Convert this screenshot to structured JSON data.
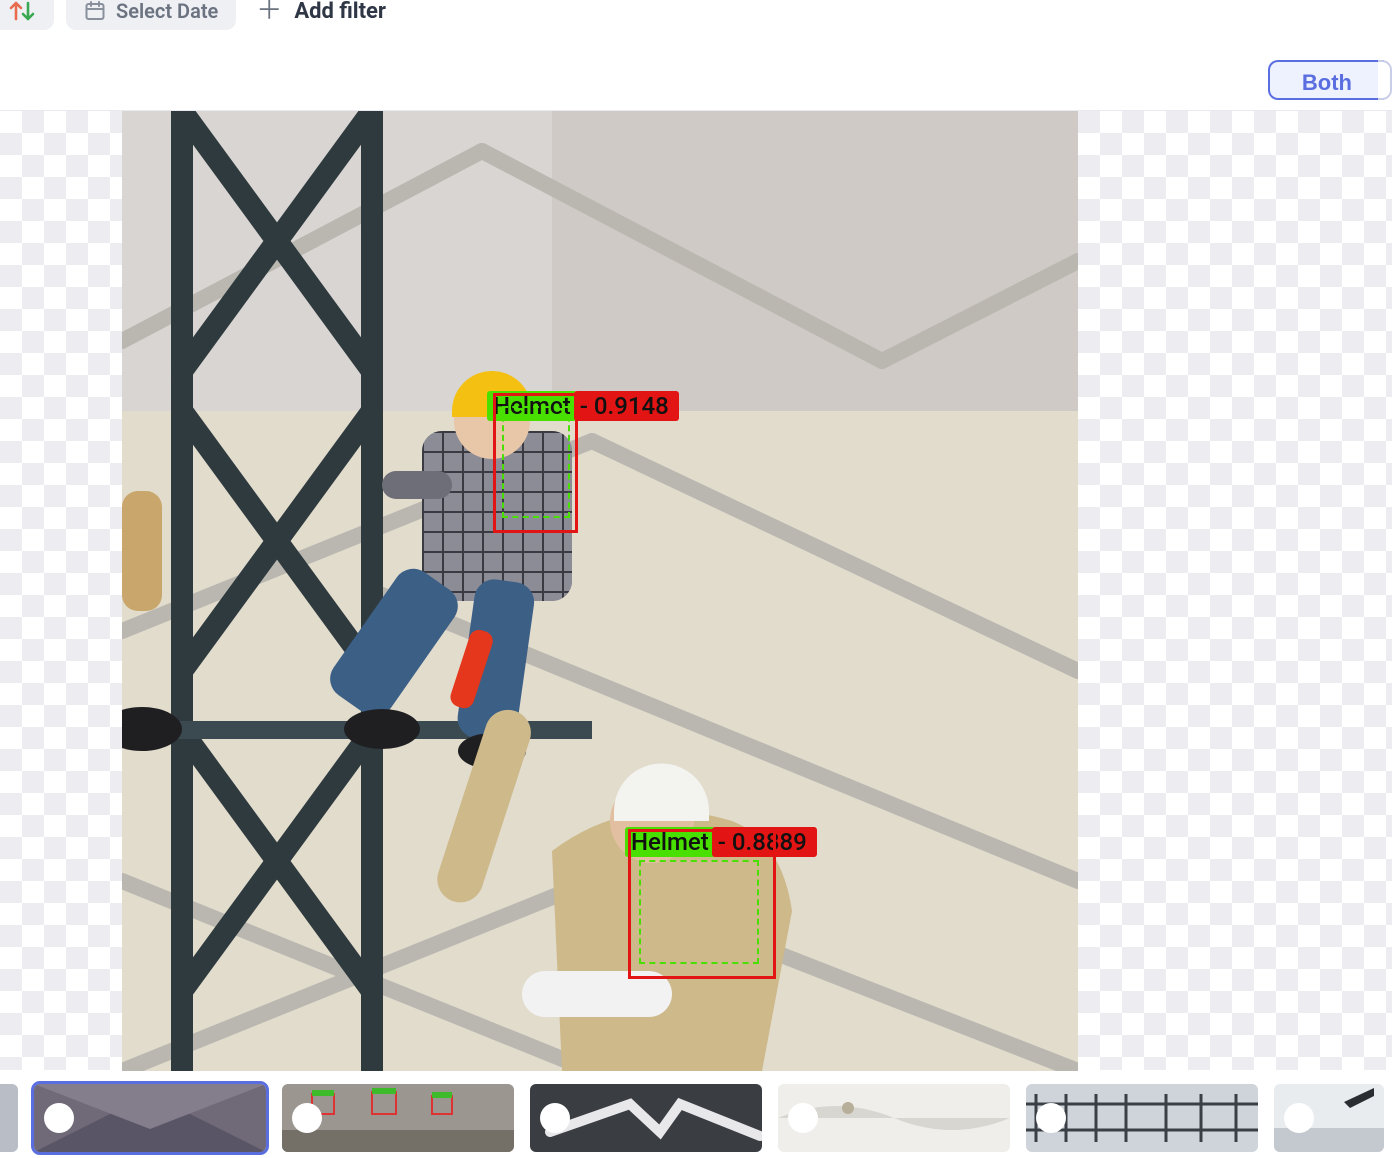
{
  "toolbar": {
    "select_date_label": "Select Date",
    "add_filter_label": "Add filter"
  },
  "view_toggle": {
    "selected_label": "Both"
  },
  "detections": [
    {
      "class_label": "Helmet",
      "score_text": "- 0.9148"
    },
    {
      "class_label": "Helmet",
      "score_text": "- 0.8889"
    }
  ],
  "thumbnails": {
    "count": 7,
    "selected_index": 1
  }
}
